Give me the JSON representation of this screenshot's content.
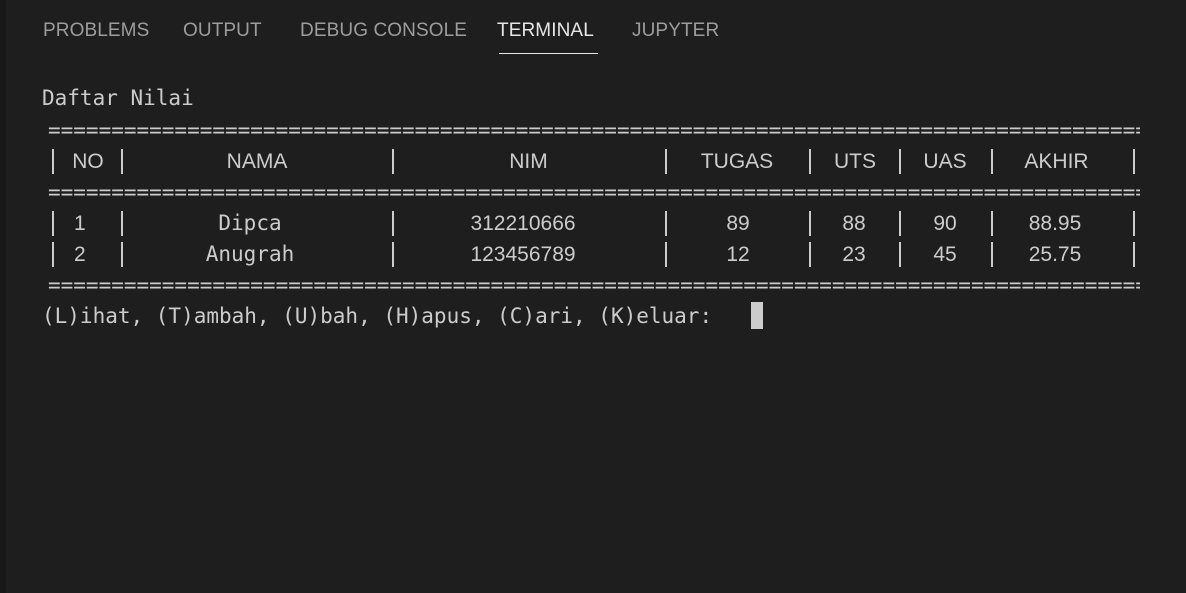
{
  "tabs": [
    {
      "label": "PROBLEMS"
    },
    {
      "label": "OUTPUT"
    },
    {
      "label": "DEBUG CONSOLE"
    },
    {
      "label": "TERMINAL"
    },
    {
      "label": "JUPYTER"
    }
  ],
  "active_tab": "TERMINAL",
  "terminal": {
    "heading": "Daftar Nilai",
    "rule": "====================================================================================================",
    "columns": [
      "NO",
      "NAMA",
      "NIM",
      "TUGAS",
      "UTS",
      "UAS",
      "AKHIR"
    ],
    "rows": [
      [
        "1",
        "Dipca",
        "312210666",
        "89",
        "88",
        "90",
        "88.95"
      ],
      [
        "2",
        "Anugrah",
        "123456789",
        "12",
        "23",
        "45",
        "25.75"
      ]
    ],
    "prompt": "(L)ihat, (T)ambah, (U)bah, (H)apus, (C)ari, (K)eluar: "
  },
  "colors": {
    "background": "#1e1e1e",
    "text": "#cccccc",
    "tab_inactive": "#9d9d9d",
    "tab_active": "#e7e7e7"
  }
}
